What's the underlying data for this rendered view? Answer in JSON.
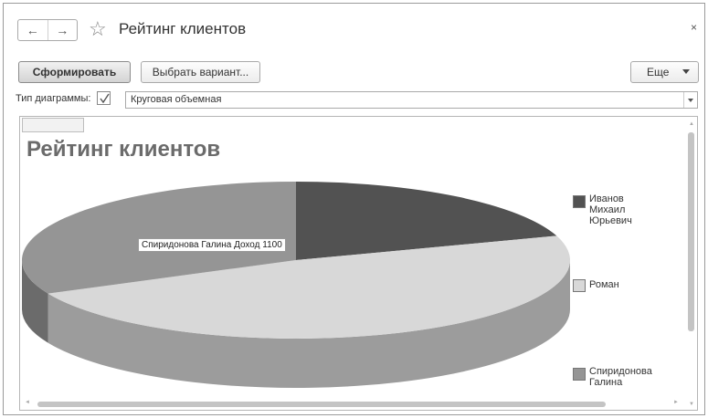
{
  "window": {
    "title": "Рейтинг клиентов",
    "back_icon": "←",
    "forward_icon": "→",
    "favorite_icon": "☆",
    "close_icon": "×"
  },
  "toolbar": {
    "generate_label": "Сформировать",
    "variant_label": "Выбрать вариант...",
    "more_label": "Еще"
  },
  "settings": {
    "chart_type_label": "Тип диаграммы:",
    "chart_type_checked": true,
    "chart_type_value": "Круговая объемная"
  },
  "chart_data": {
    "type": "pie",
    "title": "Рейтинг клиентов",
    "three_d": true,
    "series": [
      {
        "name": "Иванов Михаил Юрьевич",
        "share": 0.2,
        "color": "#525252"
      },
      {
        "name": "Роман",
        "share": 0.48,
        "color": "#d8d8d8"
      },
      {
        "name": "Спиридонова Галина",
        "share": 0.32,
        "color": "#959595"
      }
    ],
    "callout": "Спиридонова Галина Доход 1100",
    "legend_position": "right"
  }
}
